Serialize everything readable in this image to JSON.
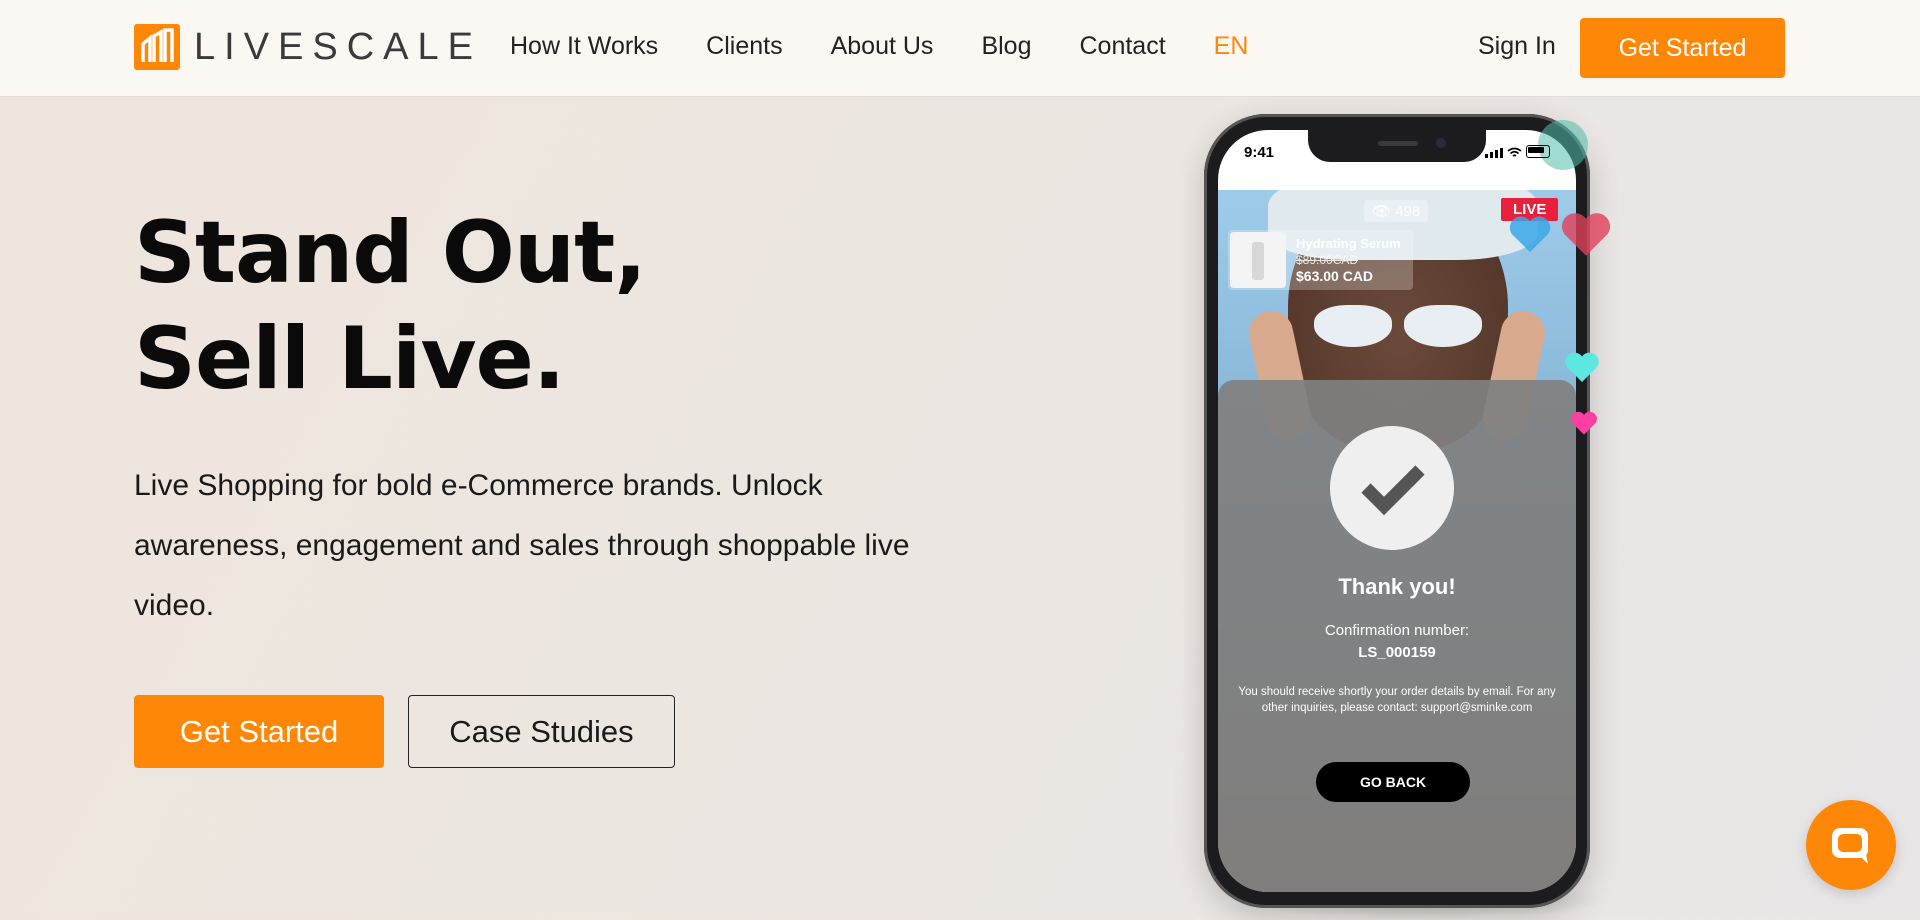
{
  "brand": {
    "logo_text": "LIVESCALE",
    "accent": "#ff8708"
  },
  "nav": {
    "links": [
      "How It Works",
      "Clients",
      "About Us",
      "Blog",
      "Contact"
    ],
    "language": "EN",
    "sign_in": "Sign In",
    "cta": "Get Started"
  },
  "hero": {
    "title_line1": "Stand Out,",
    "title_line2": "Sell Live.",
    "subtitle": "Live Shopping for bold e-Commerce brands. Unlock awareness, engagement and sales through shoppable live video.",
    "primary_cta": "Get Started",
    "secondary_cta": "Case Studies"
  },
  "phone": {
    "status_time": "9:41",
    "viewers": "498",
    "live_label": "LIVE",
    "product": {
      "name": "Hydrating Serum",
      "old_price": "$89.00CAD",
      "price": "$63.00 CAD"
    },
    "confirmation": {
      "title": "Thank you!",
      "label": "Confirmation number:",
      "number": "LS_000159",
      "note": "You should receive shortly your order details by email. For any other inquiries, please contact: support@sminke.com",
      "button": "GO BACK"
    },
    "hearts": [
      "#3aa7e8",
      "#e0405a",
      "#5ce8e0",
      "#ff3fa0"
    ]
  },
  "chat": {
    "icon": "chat-icon"
  }
}
